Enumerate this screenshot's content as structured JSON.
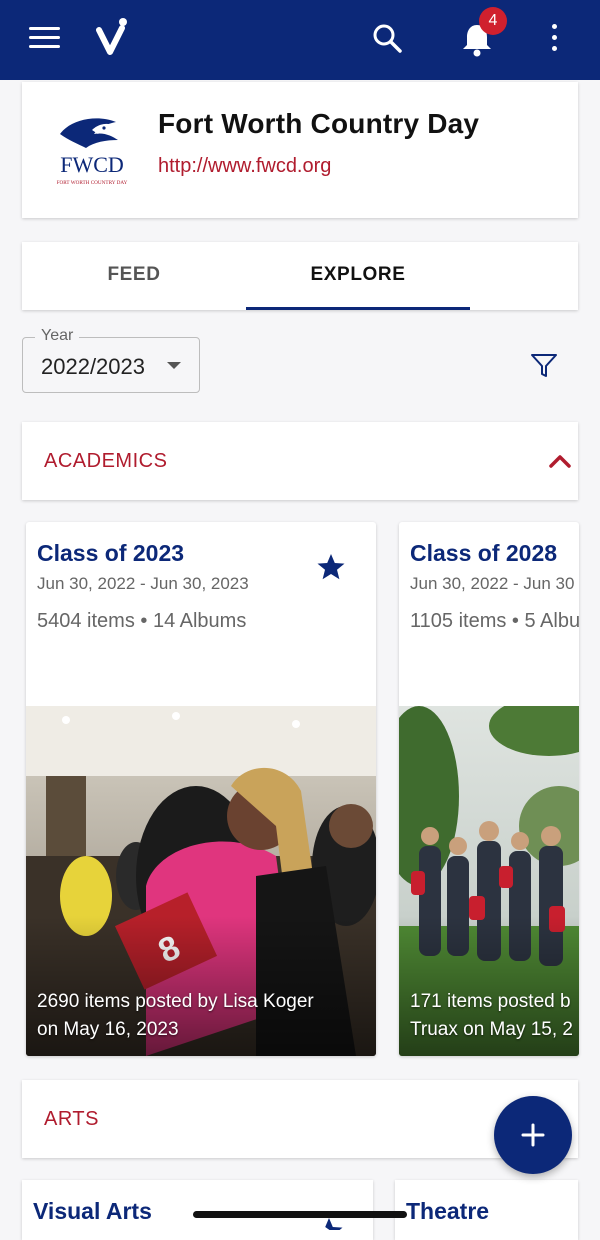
{
  "topbar": {
    "notification_count": "4",
    "colors": {
      "bar": "#0c2878",
      "badge": "#d0202e"
    }
  },
  "school": {
    "name": "Fort Worth Country Day",
    "url": "http://www.fwcd.org",
    "logo_text": "FWCD",
    "logo_subtext": "FORT WORTH COUNTRY DAY"
  },
  "tabs": [
    {
      "label": "FEED"
    },
    {
      "label": "EXPLORE",
      "active": true
    }
  ],
  "filter": {
    "year_label": "Year",
    "year_value": "2022/2023"
  },
  "sections": [
    {
      "title": "ACADEMICS",
      "expanded": true,
      "albums": [
        {
          "title": "Class of 2023",
          "dates": "Jun 30, 2022 - Jun 30, 2023",
          "counts": "5404 items • 14 Albums",
          "starred": true,
          "caption_line1": "2690 items posted by Lisa Koger",
          "caption_line2": "on May 16, 2023"
        },
        {
          "title": "Class of 2028",
          "dates": "Jun 30, 2022 - Jun 30",
          "counts": "1105 items • 5 Albu",
          "caption_line1": "171 items posted b",
          "caption_line2": "Truax on May 15, 2"
        }
      ]
    },
    {
      "title": "ARTS",
      "albums": [
        {
          "title": "Visual Arts"
        },
        {
          "title": "Theatre"
        }
      ]
    }
  ],
  "colors": {
    "accent": "#b01c2e",
    "primary": "#0c2878"
  }
}
